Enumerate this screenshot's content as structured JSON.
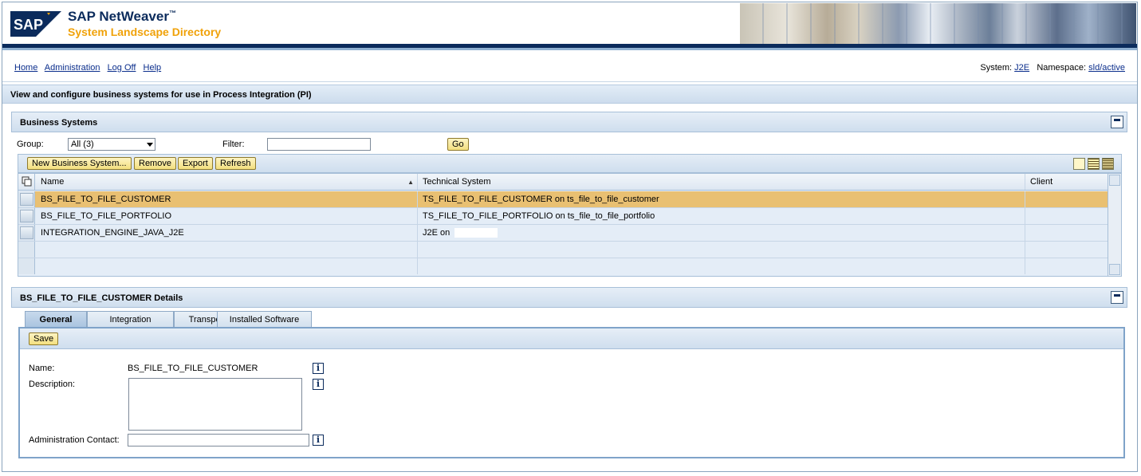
{
  "header": {
    "logo_text": "SAP",
    "title": "SAP NetWeaver",
    "trademark": "™",
    "subtitle": "System Landscape Directory"
  },
  "nav": {
    "links": [
      "Home",
      "Administration",
      "Log Off",
      "Help"
    ],
    "system_label": "System:",
    "system_value": "J2E",
    "namespace_label": "Namespace:",
    "namespace_value": "sld/active"
  },
  "page_title": "View and configure business systems for use in Process Integration (PI)",
  "business_systems": {
    "title": "Business Systems",
    "group_label": "Group:",
    "group_value": "All (3)",
    "filter_label": "Filter:",
    "filter_value": "",
    "go_label": "Go",
    "toolbar": {
      "new": "New Business System...",
      "remove": "Remove",
      "export": "Export",
      "refresh": "Refresh"
    },
    "columns": [
      "Name",
      "Technical System",
      "Client"
    ],
    "rows": [
      {
        "name": "BS_FILE_TO_FILE_CUSTOMER",
        "tech": "TS_FILE_TO_FILE_CUSTOMER on ts_file_to_file_customer",
        "client": ""
      },
      {
        "name": "BS_FILE_TO_FILE_PORTFOLIO",
        "tech": "TS_FILE_TO_FILE_PORTFOLIO on ts_file_to_file_portfolio",
        "client": ""
      },
      {
        "name": "INTEGRATION_ENGINE_JAVA_J2E",
        "tech": "J2E on",
        "client": ""
      }
    ]
  },
  "details": {
    "title": "BS_FILE_TO_FILE_CUSTOMER Details",
    "tabs": [
      "General",
      "Integration",
      "Transport",
      "Installed Software"
    ],
    "active_tab": "General",
    "save_label": "Save",
    "name_label": "Name:",
    "name_value": "BS_FILE_TO_FILE_CUSTOMER",
    "description_label": "Description:",
    "description_value": "",
    "admin_label": "Administration Contact:",
    "admin_value": ""
  },
  "colors": {
    "brand_navy": "#0b2b5c",
    "brand_orange": "#f0a20a",
    "selected_row": "#e9c072",
    "button_yellow": "#f3df7f"
  }
}
